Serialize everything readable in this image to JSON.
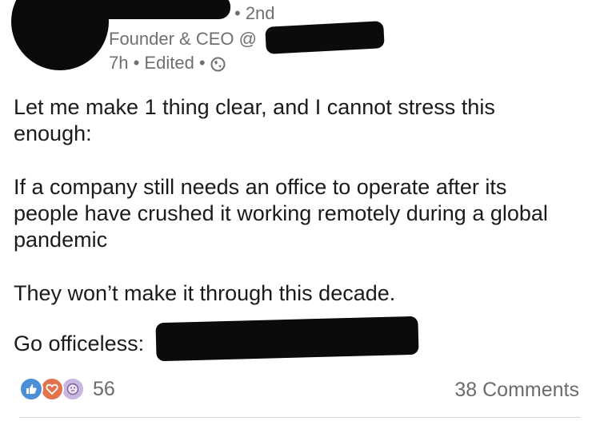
{
  "author": {
    "name": "[redacted]",
    "degree": "• 2nd",
    "headline": "Founder & CEO @",
    "time": "7h",
    "edited": "Edited",
    "visibility_icon": "globe-icon"
  },
  "post": {
    "paragraph_1": "Let me make 1 thing clear, and I cannot stress this enough:",
    "paragraph_2": "If a company still needs an office to operate after its people have crushed it working remotely during a global pandemic",
    "paragraph_3": "They won’t make it through this decade.",
    "paragraph_4": "Go officeless:"
  },
  "social": {
    "reactions": [
      "like-icon",
      "love-icon",
      "curious-icon"
    ],
    "reaction_count": "56",
    "comments_label": "38 Comments"
  },
  "colors": {
    "like": "#4b8fd6",
    "love": "#e2734d",
    "curious": "#c9b6e0",
    "meta_text": "#6f6f6f"
  }
}
